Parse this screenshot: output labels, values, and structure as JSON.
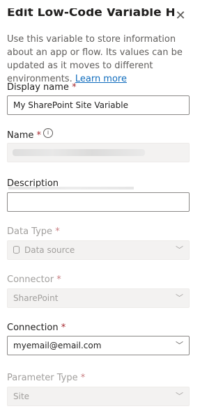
{
  "panel": {
    "title": "Edit Low-Code Variable Help Panel",
    "help_text": "Use this variable to store information about an app or flow. Its values can be updated as it moves to different environments.",
    "learn_more": "Learn more"
  },
  "fields": {
    "display_name": {
      "label": "Display name",
      "required": "*",
      "value": "My SharePoint Site Variable"
    },
    "name": {
      "label": "Name",
      "required": "*"
    },
    "description": {
      "label": "Description",
      "value": ""
    },
    "data_type": {
      "label": "Data Type",
      "required": "*",
      "value": "Data source"
    },
    "connector": {
      "label": "Connector",
      "required": "*",
      "value": "SharePoint"
    },
    "connection": {
      "label": "Connection",
      "required": "*",
      "value": "myemail@email.com"
    },
    "parameter_type": {
      "label": "Parameter Type",
      "required": "*",
      "value": "Site"
    }
  },
  "icons": {
    "close": "close-icon",
    "info": "info-icon",
    "chevron": "chevron-down-icon",
    "data_source": "database-icon"
  }
}
